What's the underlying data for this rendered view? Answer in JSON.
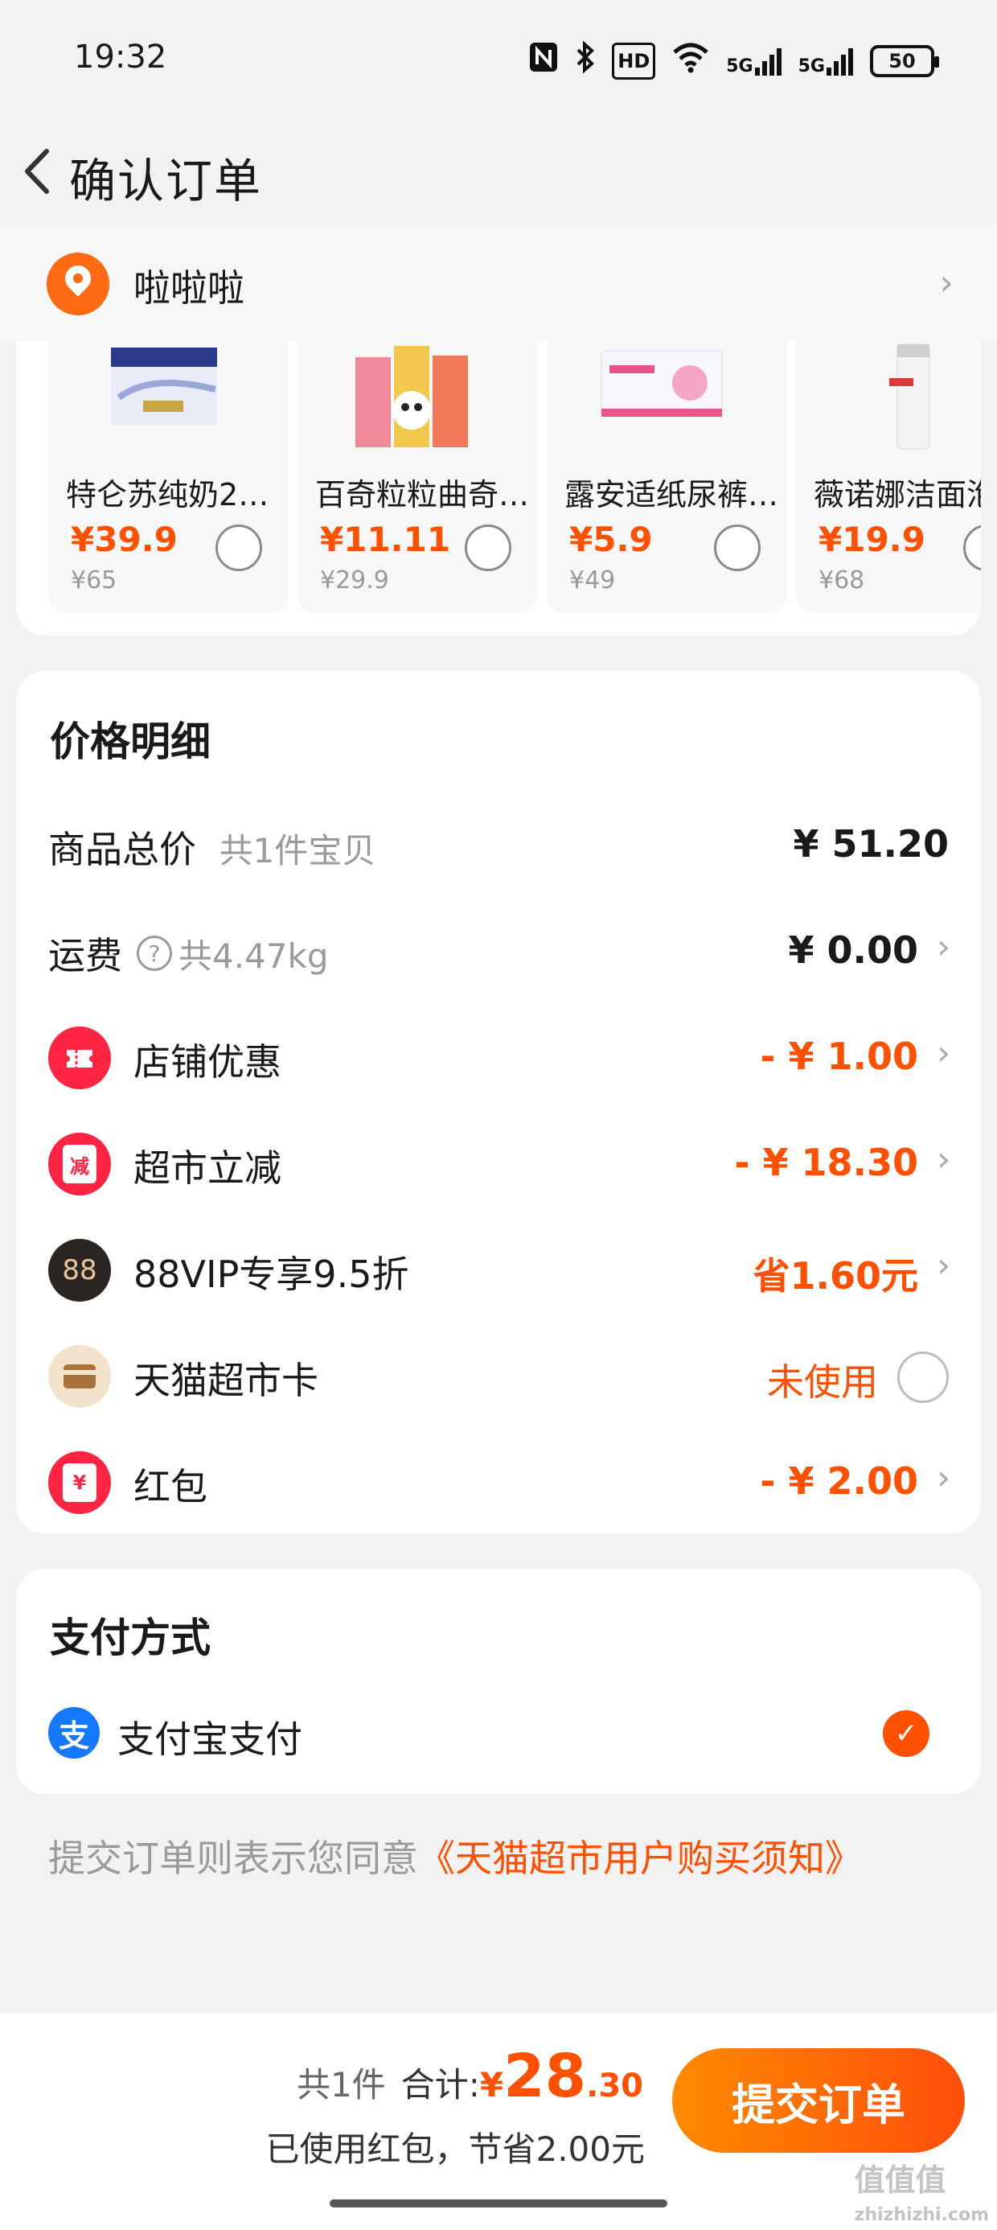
{
  "status_bar": {
    "time": "19:32",
    "icons": [
      "nfc-icon",
      "bluetooth-icon",
      "hd-icon",
      "wifi-icon",
      "5g-signal-icon",
      "5g-signal-icon"
    ],
    "hd_label": "HD",
    "signal_label": "5G",
    "battery": "50"
  },
  "header": {
    "title": "确认订单"
  },
  "address": {
    "name": "啦啦啦"
  },
  "goods": [
    {
      "name": "特仑苏纯奶25…",
      "price": "¥39.9",
      "original": "¥65"
    },
    {
      "name": "百奇粒粒曲奇…",
      "price": "¥11.11",
      "original": "¥29.9"
    },
    {
      "name": "露安适纸尿裤…",
      "price": "¥5.9",
      "original": "¥49"
    },
    {
      "name": "薇诺娜洁面泡",
      "price": "¥19.9",
      "original": "¥68"
    }
  ],
  "price_detail": {
    "title": "价格明细",
    "subtotal": {
      "label": "商品总价",
      "note": "共1件宝贝",
      "value": "¥ 51.20"
    },
    "shipping": {
      "label": "运费",
      "weight": "共4.47kg",
      "value": "¥ 0.00"
    },
    "shop_discount": {
      "label": "店铺优惠",
      "value": "- ¥ 1.00"
    },
    "market_reduce": {
      "label": "超市立减",
      "value": "- ¥ 18.30",
      "icon_text": "减"
    },
    "vip": {
      "label": "88VIP专享9.5折",
      "value": "省1.60元",
      "icon_text": "88"
    },
    "tmall_card": {
      "label": "天猫超市卡",
      "value": "未使用"
    },
    "red_packet": {
      "label": "红包",
      "value": "- ¥ 2.00",
      "icon_text": "¥"
    }
  },
  "payment": {
    "title": "支付方式",
    "method": "支付宝支付",
    "icon_text": "支"
  },
  "agreement": {
    "prefix": "提交订单则表示您同意",
    "link": "《天猫超市用户购买须知》"
  },
  "bottom_bar": {
    "count": "共1件",
    "total_label": "合计:",
    "currency": "¥",
    "total_int": "28",
    "total_dec": ".30",
    "saved": "已使用红包，节省2.00元",
    "submit": "提交订单"
  },
  "watermark": {
    "main": "值值值",
    "sub": "zhizhizhi.com"
  },
  "colors": {
    "accent": "#ff5000",
    "alipay": "#1677ff",
    "background": "#f2f2f2"
  }
}
